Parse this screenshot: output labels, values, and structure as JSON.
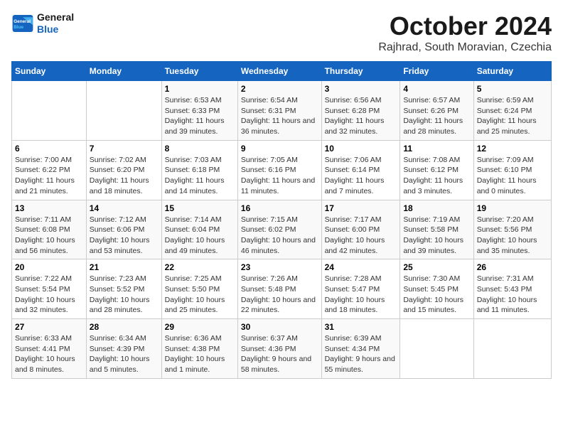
{
  "header": {
    "logo_line1": "General",
    "logo_line2": "Blue",
    "month": "October 2024",
    "location": "Rajhrad, South Moravian, Czechia"
  },
  "weekdays": [
    "Sunday",
    "Monday",
    "Tuesday",
    "Wednesday",
    "Thursday",
    "Friday",
    "Saturday"
  ],
  "weeks": [
    [
      {
        "day": "",
        "info": ""
      },
      {
        "day": "",
        "info": ""
      },
      {
        "day": "1",
        "info": "Sunrise: 6:53 AM\nSunset: 6:33 PM\nDaylight: 11 hours and 39 minutes."
      },
      {
        "day": "2",
        "info": "Sunrise: 6:54 AM\nSunset: 6:31 PM\nDaylight: 11 hours and 36 minutes."
      },
      {
        "day": "3",
        "info": "Sunrise: 6:56 AM\nSunset: 6:28 PM\nDaylight: 11 hours and 32 minutes."
      },
      {
        "day": "4",
        "info": "Sunrise: 6:57 AM\nSunset: 6:26 PM\nDaylight: 11 hours and 28 minutes."
      },
      {
        "day": "5",
        "info": "Sunrise: 6:59 AM\nSunset: 6:24 PM\nDaylight: 11 hours and 25 minutes."
      }
    ],
    [
      {
        "day": "6",
        "info": "Sunrise: 7:00 AM\nSunset: 6:22 PM\nDaylight: 11 hours and 21 minutes."
      },
      {
        "day": "7",
        "info": "Sunrise: 7:02 AM\nSunset: 6:20 PM\nDaylight: 11 hours and 18 minutes."
      },
      {
        "day": "8",
        "info": "Sunrise: 7:03 AM\nSunset: 6:18 PM\nDaylight: 11 hours and 14 minutes."
      },
      {
        "day": "9",
        "info": "Sunrise: 7:05 AM\nSunset: 6:16 PM\nDaylight: 11 hours and 11 minutes."
      },
      {
        "day": "10",
        "info": "Sunrise: 7:06 AM\nSunset: 6:14 PM\nDaylight: 11 hours and 7 minutes."
      },
      {
        "day": "11",
        "info": "Sunrise: 7:08 AM\nSunset: 6:12 PM\nDaylight: 11 hours and 3 minutes."
      },
      {
        "day": "12",
        "info": "Sunrise: 7:09 AM\nSunset: 6:10 PM\nDaylight: 11 hours and 0 minutes."
      }
    ],
    [
      {
        "day": "13",
        "info": "Sunrise: 7:11 AM\nSunset: 6:08 PM\nDaylight: 10 hours and 56 minutes."
      },
      {
        "day": "14",
        "info": "Sunrise: 7:12 AM\nSunset: 6:06 PM\nDaylight: 10 hours and 53 minutes."
      },
      {
        "day": "15",
        "info": "Sunrise: 7:14 AM\nSunset: 6:04 PM\nDaylight: 10 hours and 49 minutes."
      },
      {
        "day": "16",
        "info": "Sunrise: 7:15 AM\nSunset: 6:02 PM\nDaylight: 10 hours and 46 minutes."
      },
      {
        "day": "17",
        "info": "Sunrise: 7:17 AM\nSunset: 6:00 PM\nDaylight: 10 hours and 42 minutes."
      },
      {
        "day": "18",
        "info": "Sunrise: 7:19 AM\nSunset: 5:58 PM\nDaylight: 10 hours and 39 minutes."
      },
      {
        "day": "19",
        "info": "Sunrise: 7:20 AM\nSunset: 5:56 PM\nDaylight: 10 hours and 35 minutes."
      }
    ],
    [
      {
        "day": "20",
        "info": "Sunrise: 7:22 AM\nSunset: 5:54 PM\nDaylight: 10 hours and 32 minutes."
      },
      {
        "day": "21",
        "info": "Sunrise: 7:23 AM\nSunset: 5:52 PM\nDaylight: 10 hours and 28 minutes."
      },
      {
        "day": "22",
        "info": "Sunrise: 7:25 AM\nSunset: 5:50 PM\nDaylight: 10 hours and 25 minutes."
      },
      {
        "day": "23",
        "info": "Sunrise: 7:26 AM\nSunset: 5:48 PM\nDaylight: 10 hours and 22 minutes."
      },
      {
        "day": "24",
        "info": "Sunrise: 7:28 AM\nSunset: 5:47 PM\nDaylight: 10 hours and 18 minutes."
      },
      {
        "day": "25",
        "info": "Sunrise: 7:30 AM\nSunset: 5:45 PM\nDaylight: 10 hours and 15 minutes."
      },
      {
        "day": "26",
        "info": "Sunrise: 7:31 AM\nSunset: 5:43 PM\nDaylight: 10 hours and 11 minutes."
      }
    ],
    [
      {
        "day": "27",
        "info": "Sunrise: 6:33 AM\nSunset: 4:41 PM\nDaylight: 10 hours and 8 minutes."
      },
      {
        "day": "28",
        "info": "Sunrise: 6:34 AM\nSunset: 4:39 PM\nDaylight: 10 hours and 5 minutes."
      },
      {
        "day": "29",
        "info": "Sunrise: 6:36 AM\nSunset: 4:38 PM\nDaylight: 10 hours and 1 minute."
      },
      {
        "day": "30",
        "info": "Sunrise: 6:37 AM\nSunset: 4:36 PM\nDaylight: 9 hours and 58 minutes."
      },
      {
        "day": "31",
        "info": "Sunrise: 6:39 AM\nSunset: 4:34 PM\nDaylight: 9 hours and 55 minutes."
      },
      {
        "day": "",
        "info": ""
      },
      {
        "day": "",
        "info": ""
      }
    ]
  ]
}
